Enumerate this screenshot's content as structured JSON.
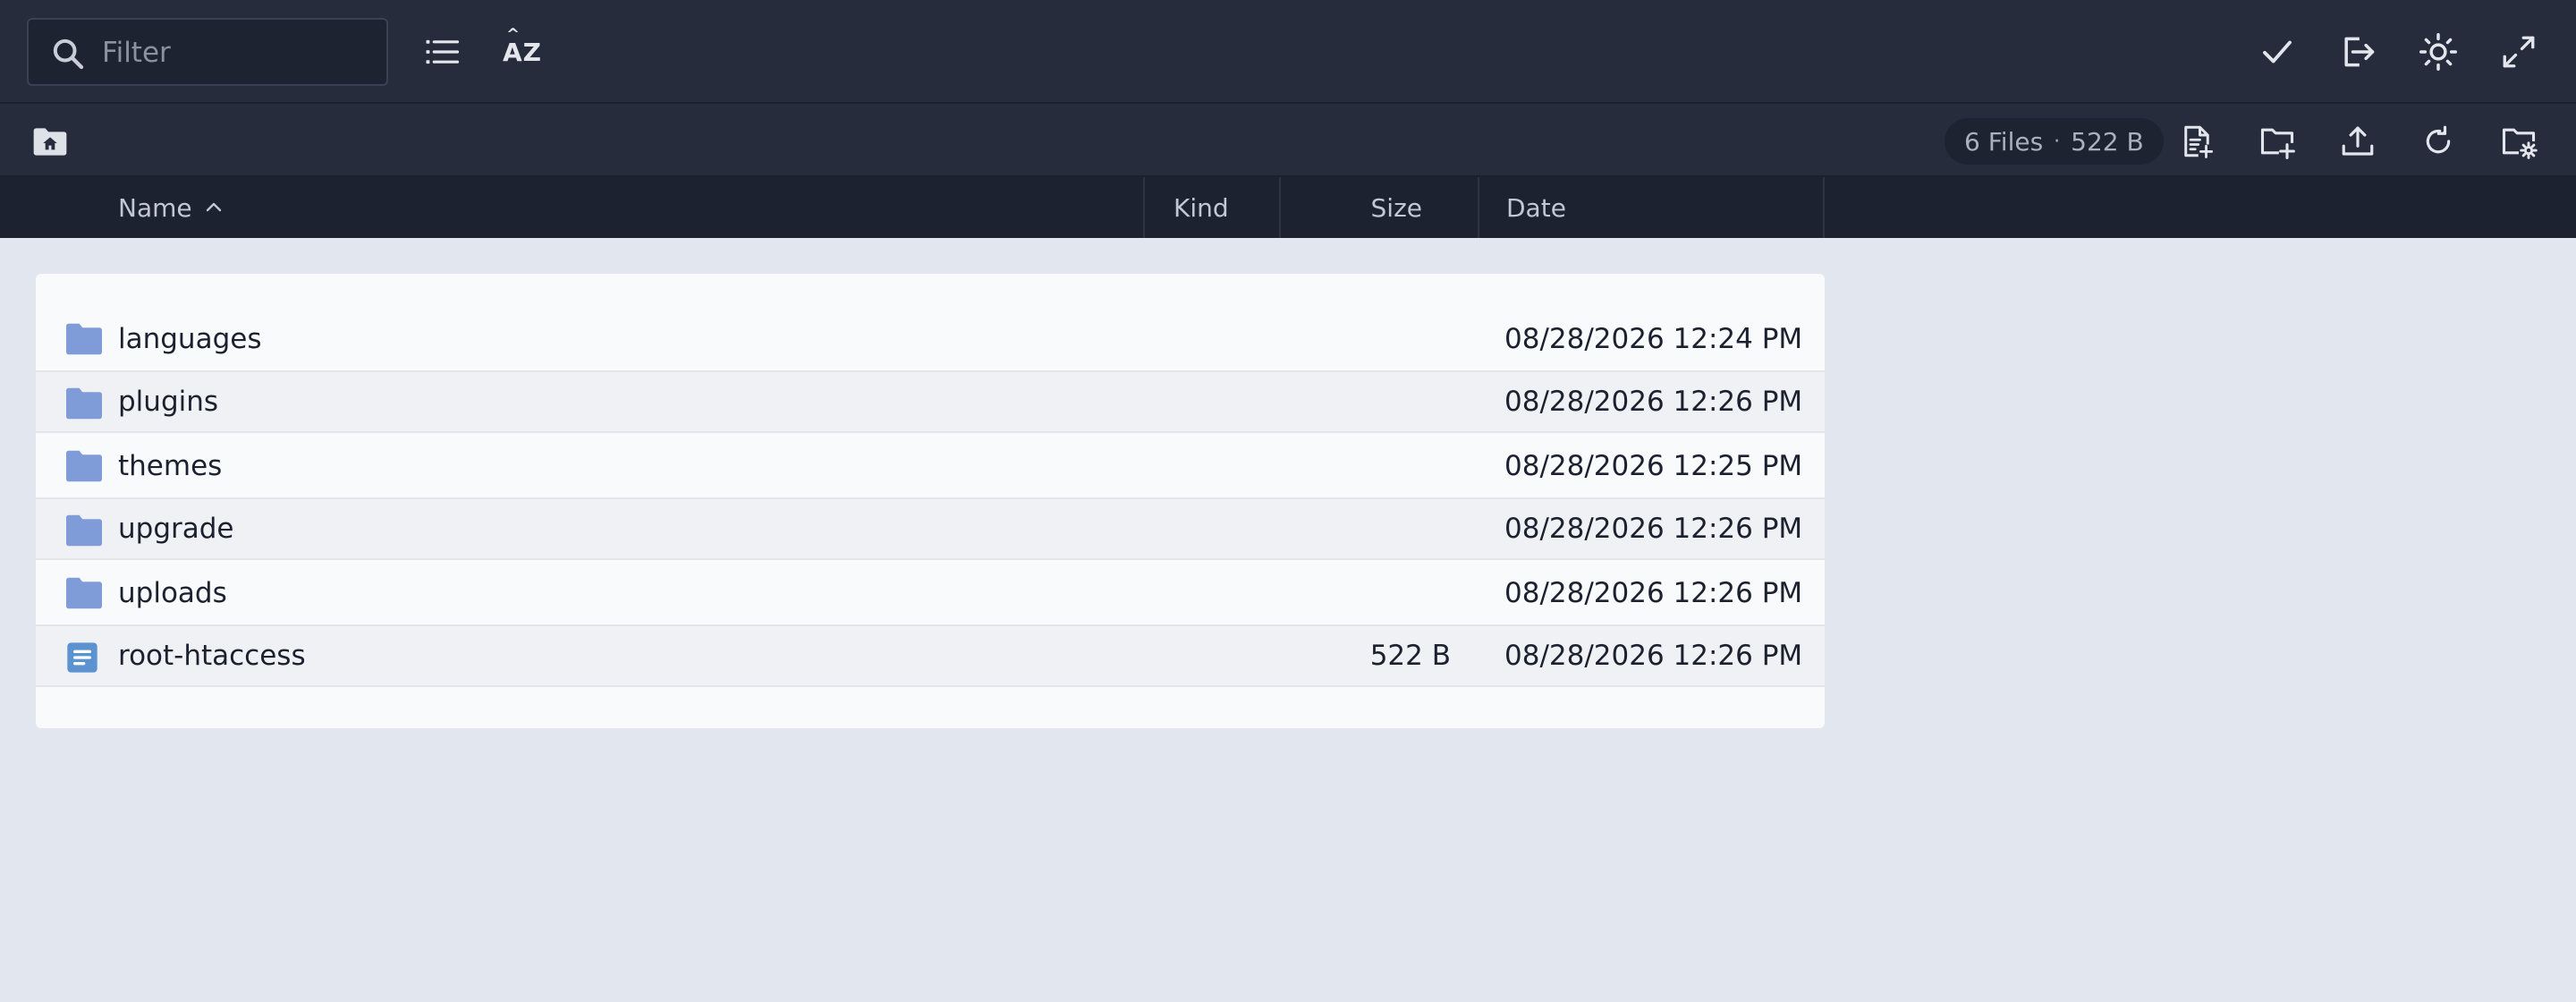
{
  "toolbar": {
    "search_placeholder": "Filter",
    "list_view_icon": "list-icon",
    "sort_icon": "sort-az-icon",
    "sort_label": "AZ",
    "right_icons": [
      "check-icon",
      "logout-icon",
      "theme-sun-icon",
      "fullscreen-icon"
    ]
  },
  "pathbar": {
    "home_icon": "folder-home-icon",
    "files_count": "6 Files",
    "separator": "·",
    "total_size": "522 B",
    "actions": [
      "new-file-icon",
      "new-folder-icon",
      "upload-icon",
      "refresh-icon",
      "folder-settings-icon"
    ]
  },
  "columns": {
    "name": "Name",
    "kind": "Kind",
    "size": "Size",
    "date": "Date",
    "sort_indicator": "chevron-up-icon"
  },
  "files": [
    {
      "name": "languages",
      "type": "folder",
      "size": "",
      "date": "08/28/2026 12:24 PM"
    },
    {
      "name": "plugins",
      "type": "folder",
      "size": "",
      "date": "08/28/2026 12:26 PM"
    },
    {
      "name": "themes",
      "type": "folder",
      "size": "",
      "date": "08/28/2026 12:25 PM"
    },
    {
      "name": "upgrade",
      "type": "folder",
      "size": "",
      "date": "08/28/2026 12:26 PM"
    },
    {
      "name": "uploads",
      "type": "folder",
      "size": "",
      "date": "08/28/2026 12:26 PM"
    },
    {
      "name": "root-htaccess",
      "type": "file",
      "size": "522 B",
      "date": "08/28/2026 12:26 PM"
    }
  ],
  "colors": {
    "toolbar_bg": "#262c3b",
    "header_bg": "#1d2230",
    "page_bg": "#e2e6ee",
    "folder": "#7f9cd8",
    "file": "#5b93d0"
  }
}
